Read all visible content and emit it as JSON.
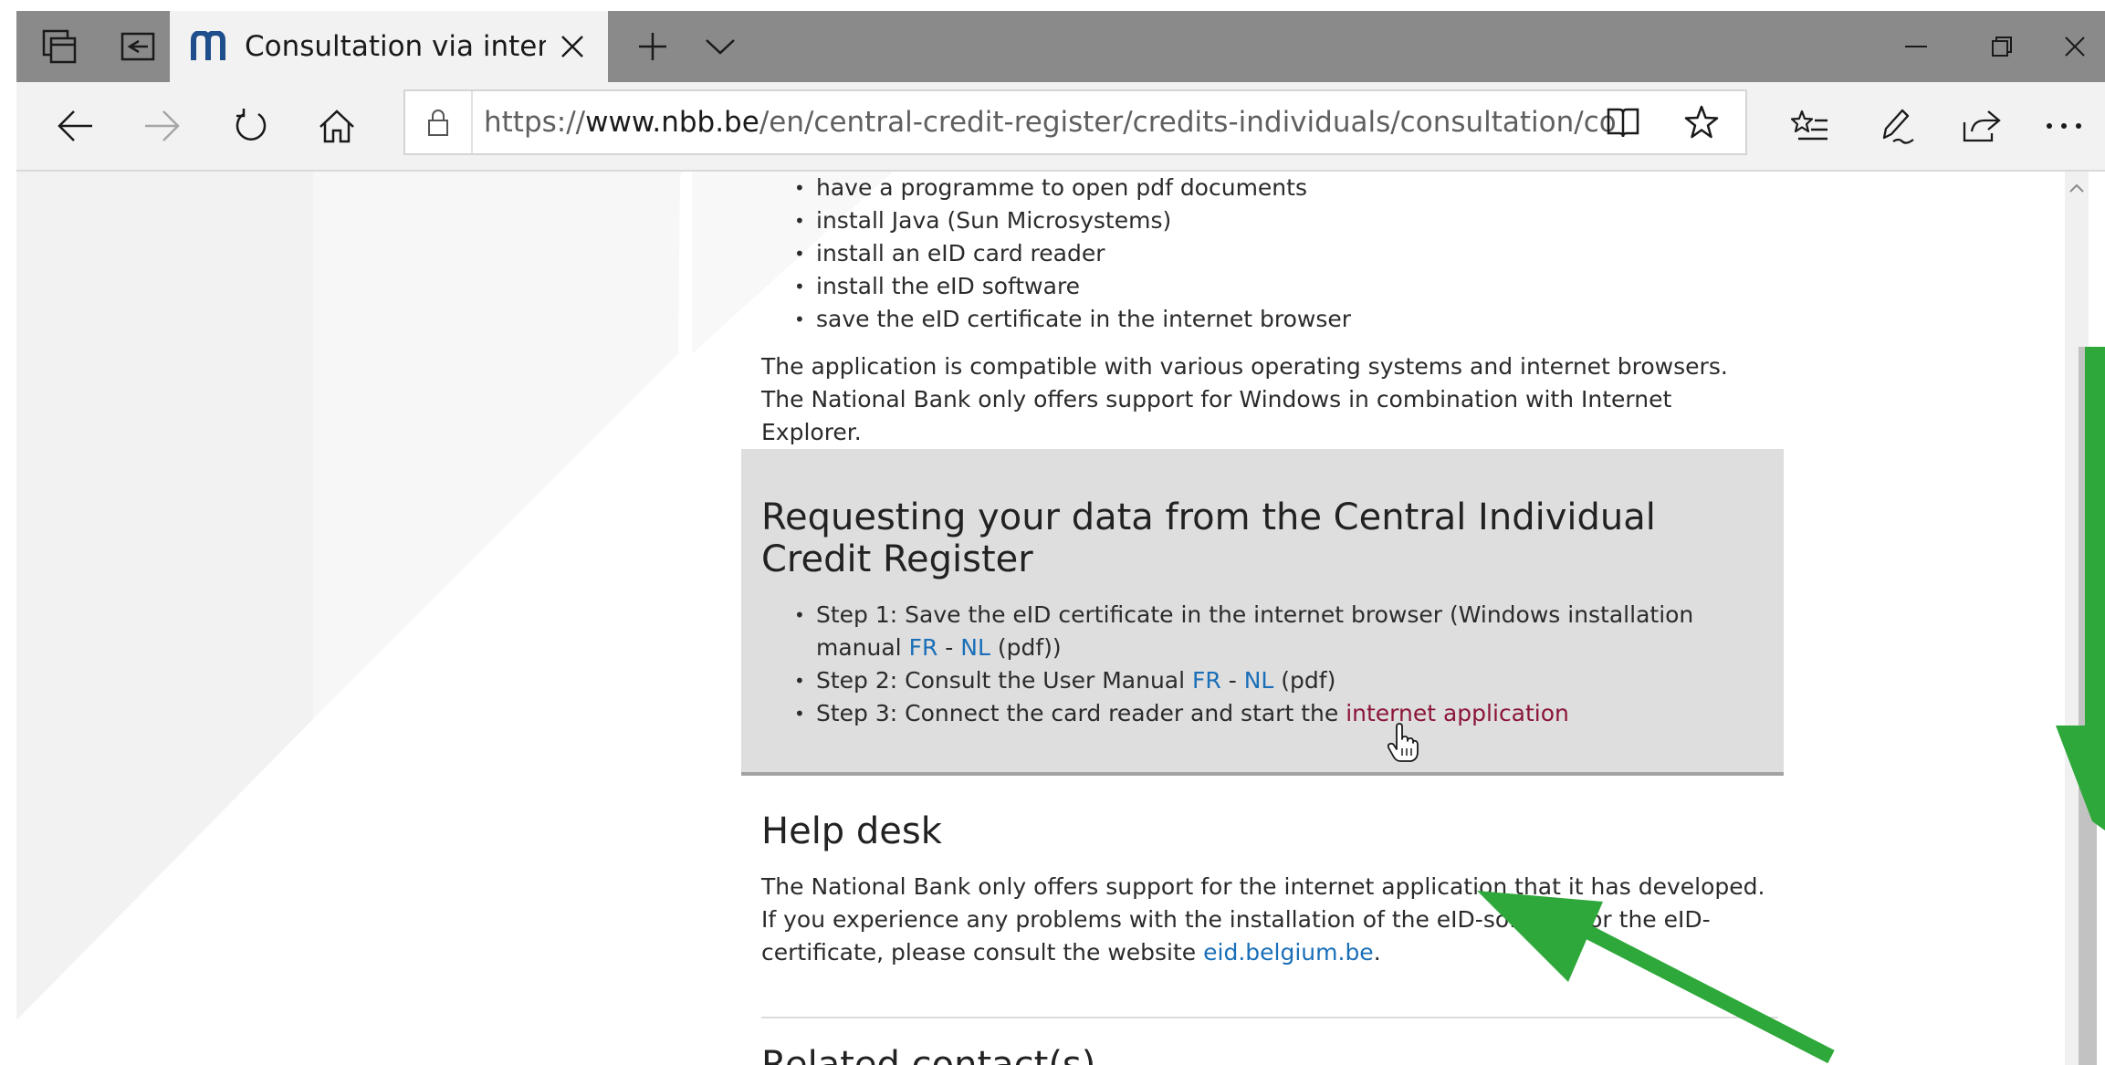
{
  "browser": {
    "tab_title": "Consultation via interne",
    "url_scheme": "https://",
    "url_domain": "www.nbb.be",
    "url_path": "/en/central-credit-register/credits-individuals/consultation/consultation-via-internet"
  },
  "icons": {
    "tab_actions": "tab-actions-icon",
    "set_aside": "set-aside-tabs-icon",
    "site_favicon": "nbb-favicon",
    "close_tab": "close-icon",
    "new_tab": "plus-icon",
    "tab_list": "chevron-down-icon",
    "minimize": "minimize-icon",
    "restore": "restore-icon",
    "close_window": "close-icon",
    "back": "back-arrow-icon",
    "forward": "forward-arrow-icon",
    "refresh": "refresh-icon",
    "home": "home-icon",
    "lock": "lock-icon",
    "reading_view": "book-icon",
    "favorite": "star-icon",
    "favorites_hub": "favorites-list-icon",
    "notes": "pen-icon",
    "share": "share-icon",
    "more": "ellipsis-icon",
    "cursor": "hand-cursor-icon"
  },
  "colors": {
    "link": "#1a6fb8",
    "visited_link": "#8b1538",
    "annotation_arrow": "#2ea83a"
  },
  "page": {
    "requirements": [
      "have a programme to open pdf documents",
      "install Java (Sun Microsystems)",
      "install an eID card reader",
      "install the eID software",
      "save the eID certificate in the internet browser"
    ],
    "compat_paragraph": "The application is compatible with various operating systems and internet browsers. The National Bank only offers support for Windows in combination with Internet Explorer.",
    "request_section": {
      "heading": "Requesting your data from the Central Individual Credit Register",
      "step1_text": "Step 1: Save the eID certificate in the internet browser (Windows installation manual ",
      "step1_fr": "FR",
      "step1_sep": " - ",
      "step1_nl": "NL",
      "step1_suffix": " (pdf))",
      "step2_text": "Step 2: Consult the User Manual ",
      "step2_fr": "FR",
      "step2_sep": " - ",
      "step2_nl": "NL",
      "step2_suffix": " (pdf)",
      "step3_text": "Step 3: Connect the card reader and start the ",
      "step3_link": "internet application"
    },
    "helpdesk": {
      "heading": "Help desk",
      "text_before": "The National Bank only offers support for the internet application that it has developed. If you experience any problems with the installation of the eID-software or the eID-certificate, please consult the website ",
      "link": "eid.belgium.be",
      "text_after": "."
    },
    "next_heading": "Related contact(s)"
  }
}
